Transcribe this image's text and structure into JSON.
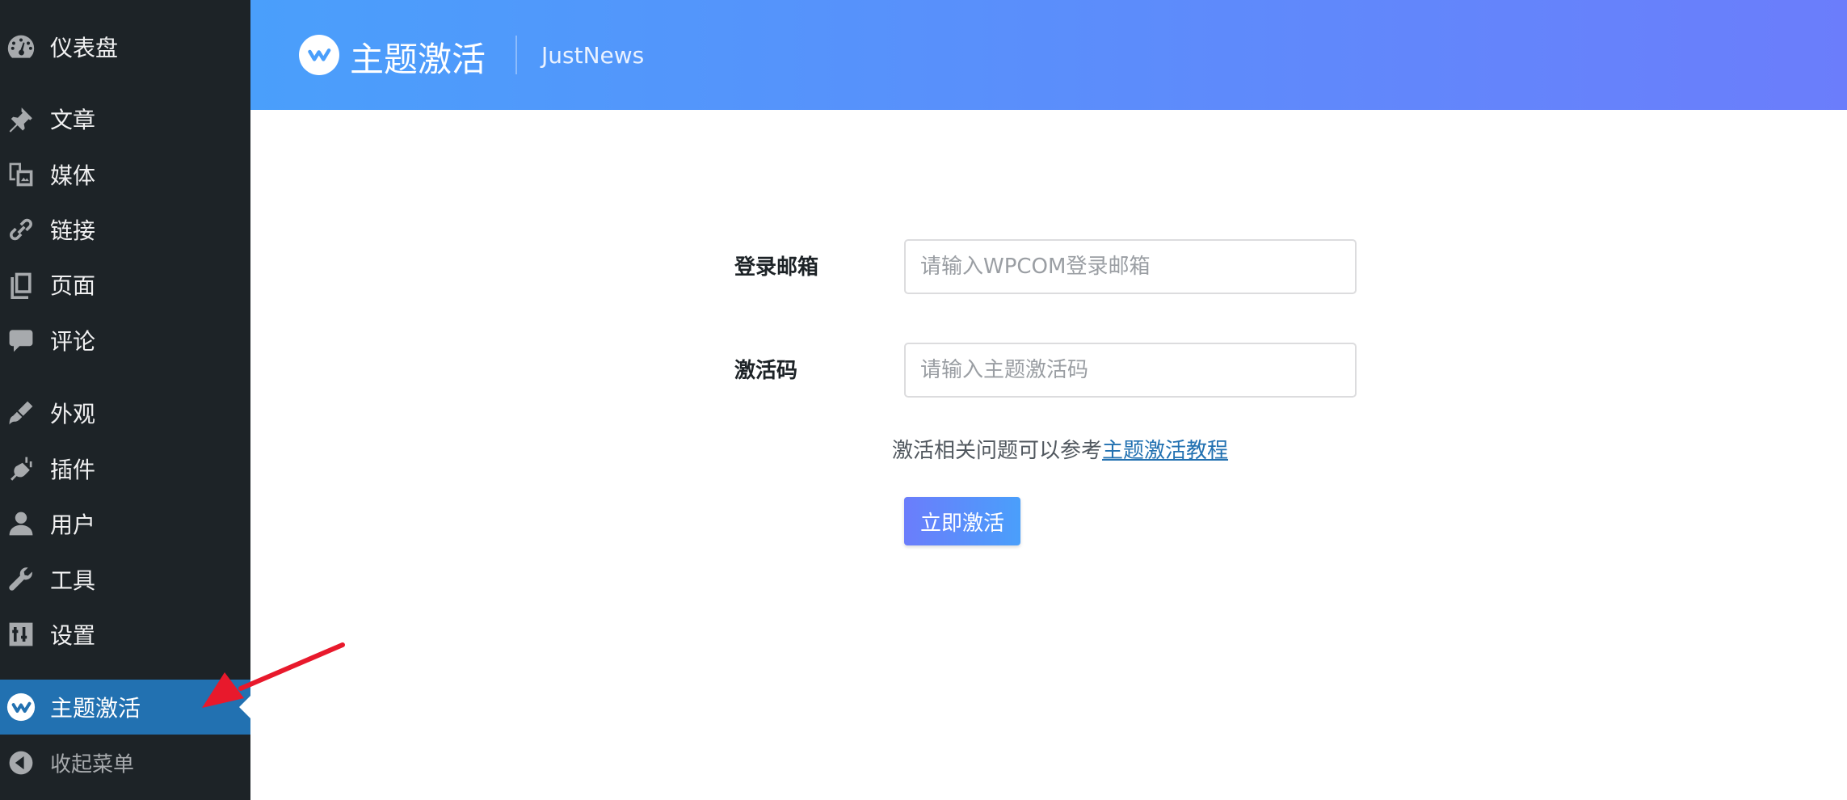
{
  "sidebar": {
    "items": [
      {
        "label": "仪表盘",
        "icon": "dashboard-icon"
      },
      {
        "label": "文章",
        "icon": "pin-icon"
      },
      {
        "label": "媒体",
        "icon": "media-icon"
      },
      {
        "label": "链接",
        "icon": "link-icon"
      },
      {
        "label": "页面",
        "icon": "page-icon"
      },
      {
        "label": "评论",
        "icon": "comment-icon"
      },
      {
        "label": "外观",
        "icon": "paintbrush-icon"
      },
      {
        "label": "插件",
        "icon": "plugin-icon"
      },
      {
        "label": "用户",
        "icon": "user-icon"
      },
      {
        "label": "工具",
        "icon": "wrench-icon"
      },
      {
        "label": "设置",
        "icon": "settings-icon"
      },
      {
        "label": "主题激活",
        "icon": "wpcom-logo-icon",
        "active": true
      },
      {
        "label": "收起菜单",
        "icon": "collapse-icon"
      }
    ]
  },
  "header": {
    "title": "主题激活",
    "subtitle": "JustNews",
    "logo": "wpcom-logo-icon"
  },
  "form": {
    "email_label": "登录邮箱",
    "email_placeholder": "请输入WPCOM登录邮箱",
    "email_value": "",
    "code_label": "激活码",
    "code_placeholder": "请输入主题激活码",
    "code_value": "",
    "help_text": "激活相关问题可以参考",
    "help_link": "主题激活教程",
    "submit_label": "立即激活"
  },
  "colors": {
    "sidebar_bg": "#1d2327",
    "active_bg": "#2271b1",
    "header_gradient_start": "#4a9ffb",
    "header_gradient_end": "#6b7dfb",
    "link": "#2271b1",
    "annotation_arrow": "#e8192c"
  }
}
